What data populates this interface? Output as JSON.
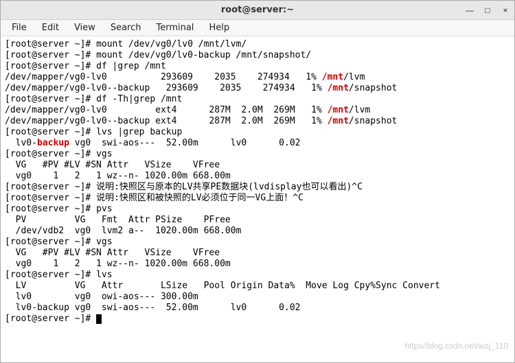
{
  "window": {
    "title": "root@server:~",
    "controls": {
      "min": "—",
      "max": "□",
      "close": "×"
    }
  },
  "menus": {
    "file": "File",
    "edit": "Edit",
    "view": "View",
    "search": "Search",
    "terminal": "Terminal",
    "help": "Help"
  },
  "prompt": "[root@server ~]# ",
  "lines": {
    "l01_cmd": "mount /dev/vg0/lv0 /mnt/lvm/",
    "l02_cmd": "mount /dev/vg0/lv0-backup /mnt/snapshot/",
    "l03_cmd": "df |grep /mnt",
    "l04_a": "/dev/mapper/vg0-lv0          293609    2035    274934   1% ",
    "l04_b": "/mnt",
    "l04_c": "/lvm",
    "l05_a": "/dev/mapper/vg0-lv0--backup   293609    2035    274934   1% ",
    "l05_b": "/mnt",
    "l05_c": "/snapshot",
    "l06_cmd": "df -Th|grep /mnt",
    "l07_a": "/dev/mapper/vg0-lv0         ext4      287M  2.0M  269M   1% ",
    "l07_b": "/mnt",
    "l07_c": "/lvm",
    "l08_a": "/dev/mapper/vg0-lv0--backup ext4      287M  2.0M  269M   1% ",
    "l08_b": "/mnt",
    "l08_c": "/snapshot",
    "l09_cmd": "lvs |grep backup",
    "l10_a": "  lv0-",
    "l10_b": "backup",
    "l10_c": " vg0  swi-aos---  52.00m      lv0      0.02",
    "l11_cmd": "vgs",
    "l12": "  VG   #PV #LV #SN Attr   VSize    VFree",
    "l13": "  vg0    1   2   1 wz--n- 1020.00m 668.00m",
    "l14_cmd": "说明:快照区与原本的LV共享PE数据块(lvdisplay也可以看出)^C",
    "l15_cmd": "说明:快照区和被快照的LV必须位于同一VG上面！^C",
    "l16_cmd": "pvs",
    "l17": "  PV         VG   Fmt  Attr PSize    PFree",
    "l18": "  /dev/vdb2  vg0  lvm2 a--  1020.00m 668.00m",
    "l19_cmd": "vgs",
    "l20": "  VG   #PV #LV #SN Attr   VSize    VFree",
    "l21": "  vg0    1   2   1 wz--n- 1020.00m 668.00m",
    "l22_cmd": "lvs",
    "l23": "  LV         VG   Attr       LSize   Pool Origin Data%  Move Log Cpy%Sync Convert",
    "l24": "  lv0        vg0  owi-aos--- 300.00m",
    "l25": "  lv0-backup vg0  swi-aos---  52.00m      lv0      0.02",
    "l26_cmd": ""
  },
  "watermark": "https//blog.csdn.net/wzj_110"
}
